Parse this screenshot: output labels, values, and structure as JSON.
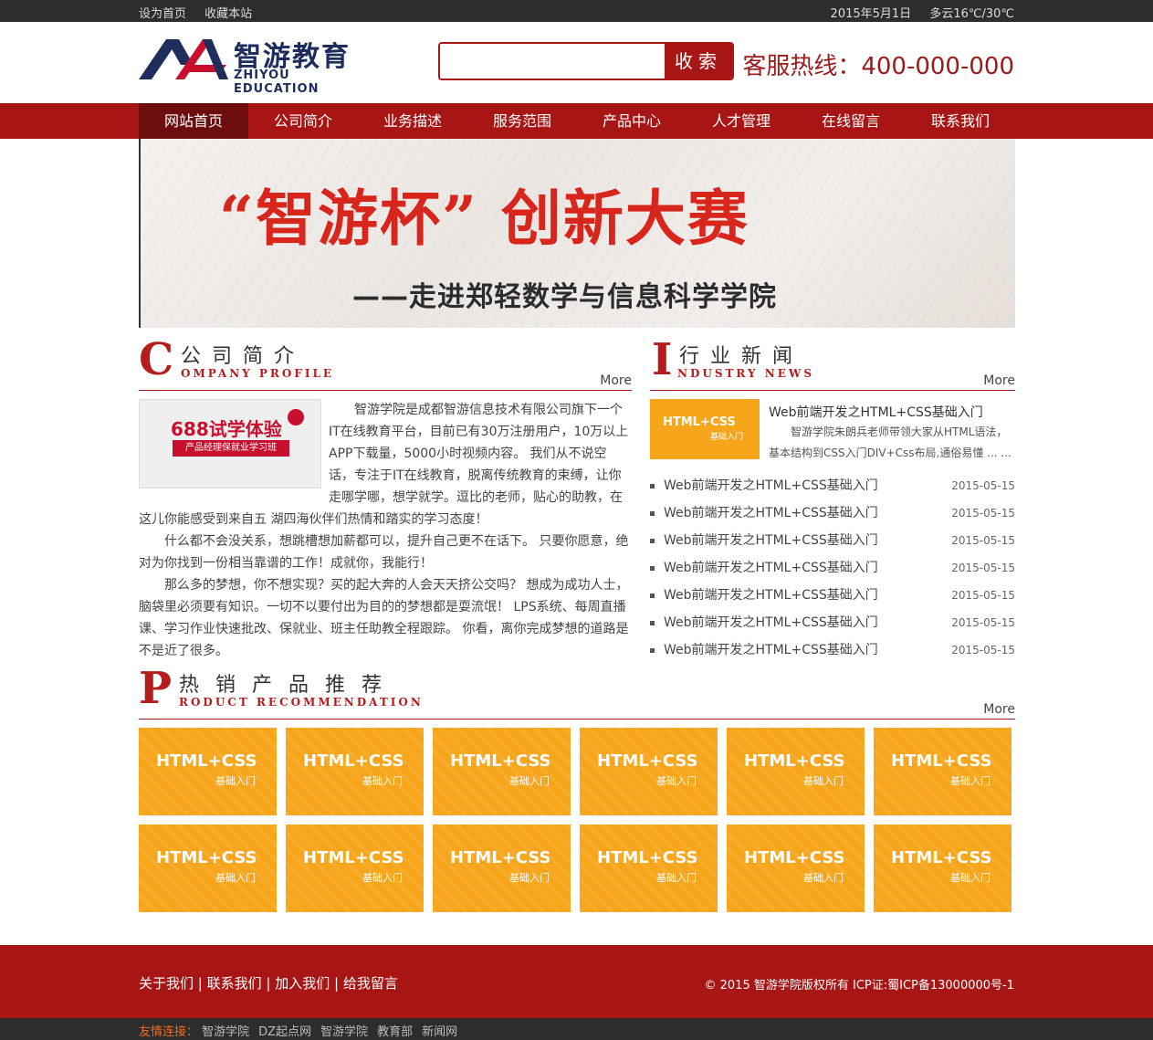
{
  "topbar": {
    "set_home": "设为首页",
    "bookmark": "收藏本站",
    "date": "2015年5月1日",
    "weather": "多云16℃/30℃"
  },
  "header": {
    "logo_cn": "智游教育",
    "logo_en": "ZHIYOU  EDUCATION",
    "search_placeholder": "",
    "search_button": "收索",
    "hotline": "客服热线：400-000-000"
  },
  "nav": {
    "items": [
      "网站首页",
      "公司简介",
      "业务描述",
      "服务范围",
      "产品中心",
      "人才管理",
      "在线留言",
      "联系我们"
    ],
    "active_index": 0
  },
  "banner": {
    "headline": "“智游杯” 创新大赛",
    "subline": "——走进郑轻数学与信息科学学院"
  },
  "company": {
    "letter": "C",
    "title_cn": "公司简介",
    "title_en": "OMPANY PROFILE",
    "more": "More",
    "image": {
      "line1": "688试学体验",
      "line2": "产品经理保就业学习班"
    },
    "paragraphs": [
      "智游学院是成都智游信息技术有限公司旗下一个IT在线教育平台，目前已有30万注册用户，10万以上APP下载量，5000小时视频内容。 我们从不说空话，专注于IT在线教育，脱离传统教育的束缚，让你走哪学哪，想学就学。逗比的老师，贴心的助教，在这儿你能感受到来自五 湖四海伙伴们热情和踏实的学习态度！",
      "什么都不会没关系，想跳槽想加薪都可以，提升自己更不在话下。 只要你愿意，绝对为你找到一份相当靠谱的工作！成就你，我能行！",
      "那么多的梦想，你不想实现？买的起大奔的人会天天挤公交吗？ 想成为成功人士，脑袋里必须要有知识。一切不以要付出为目的的梦想都是耍流氓！ LPS系统、每周直播课、学习作业快速批改、保就业、班主任助教全程跟踪。 你看，离你完成梦想的道路是不是近了很多。"
    ]
  },
  "news": {
    "letter": "I",
    "title_cn": "行业新闻",
    "title_en": "NDUSTRY NEWS",
    "more": "More",
    "feature": {
      "img_line1": "HTML+CSS",
      "img_line2": "基础入门",
      "title": "Web前端开发之HTML+CSS基础入门",
      "desc": "智游学院朱朗兵老师带领大家从HTML语法，基本结构到CSS入门DIV+Css布局,通俗易懂 ... ..."
    },
    "items": [
      {
        "title": "Web前端开发之HTML+CSS基础入门",
        "date": "2015-05-15"
      },
      {
        "title": "Web前端开发之HTML+CSS基础入门",
        "date": "2015-05-15"
      },
      {
        "title": "Web前端开发之HTML+CSS基础入门",
        "date": "2015-05-15"
      },
      {
        "title": "Web前端开发之HTML+CSS基础入门",
        "date": "2015-05-15"
      },
      {
        "title": "Web前端开发之HTML+CSS基础入门",
        "date": "2015-05-15"
      },
      {
        "title": "Web前端开发之HTML+CSS基础入门",
        "date": "2015-05-15"
      },
      {
        "title": "Web前端开发之HTML+CSS基础入门",
        "date": "2015-05-15"
      }
    ]
  },
  "products": {
    "letter": "P",
    "title_cn": "热销产品推荐",
    "title_en": "RODUCT RECOMMENDATION",
    "more": "More",
    "items": [
      {
        "line1": "HTML+CSS",
        "line2": "基础入门"
      },
      {
        "line1": "HTML+CSS",
        "line2": "基础入门"
      },
      {
        "line1": "HTML+CSS",
        "line2": "基础入门"
      },
      {
        "line1": "HTML+CSS",
        "line2": "基础入门"
      },
      {
        "line1": "HTML+CSS",
        "line2": "基础入门"
      },
      {
        "line1": "HTML+CSS",
        "line2": "基础入门"
      },
      {
        "line1": "HTML+CSS",
        "line2": "基础入门"
      },
      {
        "line1": "HTML+CSS",
        "line2": "基础入门"
      },
      {
        "line1": "HTML+CSS",
        "line2": "基础入门"
      },
      {
        "line1": "HTML+CSS",
        "line2": "基础入门"
      },
      {
        "line1": "HTML+CSS",
        "line2": "基础入门"
      },
      {
        "line1": "HTML+CSS",
        "line2": "基础入门"
      }
    ]
  },
  "footer": {
    "links": [
      "关于我们",
      "联系我们",
      "加入我们",
      "给我留言"
    ],
    "separator": " | ",
    "copyright": "© 2015 智游学院版权所有 ICP证:蜀ICP备13000000号-1"
  },
  "friends": {
    "label": "友情连接：",
    "links": [
      "智游学院",
      "DZ起点网",
      "智游学院",
      "教育部",
      "新闻网"
    ]
  },
  "colors": {
    "brand_red": "#a81515",
    "dark_red": "#6e0d0d",
    "orange": "#f7a51b",
    "logo_navy": "#1f2d5c"
  }
}
